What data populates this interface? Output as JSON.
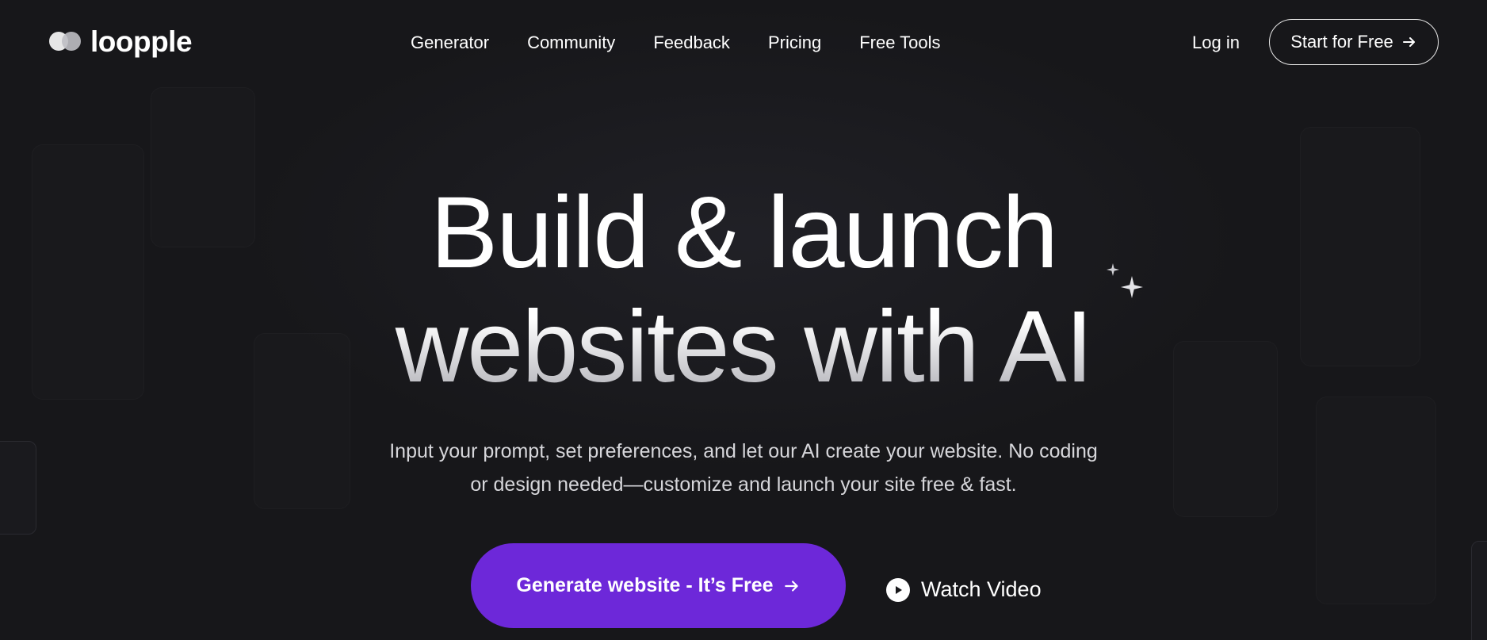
{
  "brand": {
    "name": "loopple",
    "logo_icon": "two-overlapping-circles-logo"
  },
  "nav": {
    "items": [
      {
        "label": "Generator"
      },
      {
        "label": "Community"
      },
      {
        "label": "Feedback"
      },
      {
        "label": "Pricing"
      },
      {
        "label": "Free Tools"
      }
    ]
  },
  "header": {
    "login_label": "Log in",
    "start_label": "Start for Free",
    "start_icon": "arrow-right-icon"
  },
  "hero": {
    "title_line1": "Build & launch",
    "title_line2": "websites with AI",
    "sparkle_icon": "sparkles-icon",
    "subtitle": "Input your prompt, set preferences, and let our AI create your website. No coding or design needed—customize and launch your site free & fast.",
    "cta_label": "Generate website - It’s Free",
    "cta_icon": "arrow-right-icon",
    "watch_label": "Watch Video",
    "watch_icon": "play-icon"
  },
  "colors": {
    "background": "#17171a",
    "accent": "#6d28d9",
    "text": "#ffffff",
    "muted_text": "#d6d6da"
  }
}
